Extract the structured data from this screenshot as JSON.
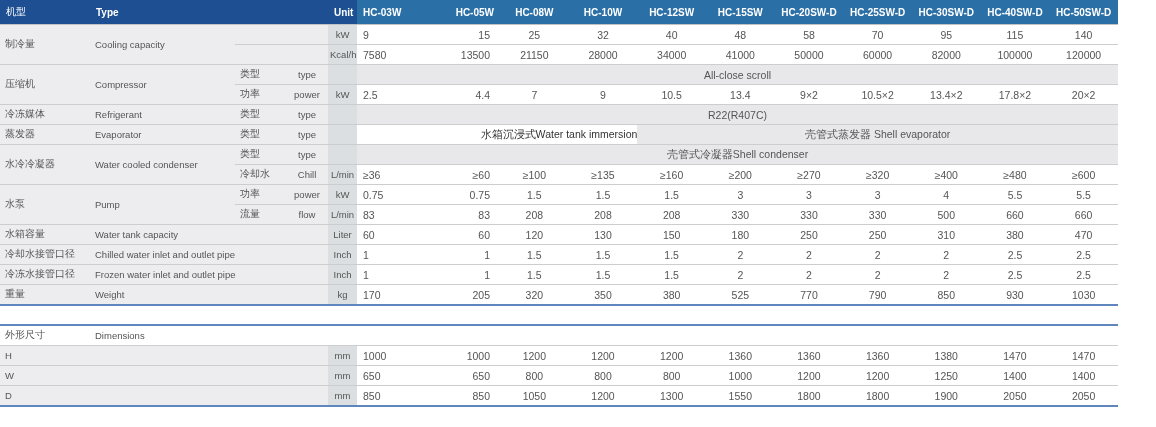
{
  "header": {
    "type_zh": "机型",
    "type_en": "Type",
    "unit": "Unit",
    "models": [
      "HC-03W",
      "HC-05W",
      "HC-08W",
      "HC-10W",
      "HC-12SW",
      "HC-15SW",
      "HC-20SW-D",
      "HC-25SW-D",
      "HC-30SW-D",
      "HC-40SW-D",
      "HC-50SW-D"
    ]
  },
  "specs": [
    {
      "zh": "制冷量",
      "en": "Cooling capacity",
      "rows": [
        {
          "unit": "kW",
          "values": [
            "9",
            "15",
            "25",
            "32",
            "40",
            "48",
            "58",
            "70",
            "95",
            "115",
            "140"
          ]
        },
        {
          "unit": "Kcal/h",
          "values": [
            "7580",
            "13500",
            "21150",
            "28000",
            "34000",
            "41000",
            "50000",
            "60000",
            "82000",
            "100000",
            "120000"
          ]
        }
      ]
    },
    {
      "zh": "压缩机",
      "en": "Compressor",
      "rows": [
        {
          "sub_zh": "类型",
          "sub_en": "type",
          "segments": [
            {
              "text": "All-close scroll",
              "shaded": true
            }
          ]
        },
        {
          "sub_zh": "功率",
          "sub_en": "power",
          "unit": "kW",
          "values": [
            "2.5",
            "4.4",
            "7",
            "9",
            "10.5",
            "13.4",
            "9×2",
            "10.5×2",
            "13.4×2",
            "17.8×2",
            "20×2"
          ]
        }
      ]
    },
    {
      "zh": "冷冻媒体",
      "en": "Refrigerant",
      "rows": [
        {
          "sub_zh": "类型",
          "sub_en": "type",
          "segments": [
            {
              "text": "R22(R407C)",
              "shaded": true
            }
          ]
        }
      ]
    },
    {
      "zh": "蒸发器",
      "en": "Evaporator",
      "rows": [
        {
          "sub_zh": "类型",
          "sub_en": "type",
          "segments": [
            {
              "text": "水箱沉浸式Water tank immersion",
              "shaded": false
            },
            {
              "text": "壳管式蒸发器 Shell evaporator",
              "shaded": true
            }
          ]
        }
      ]
    },
    {
      "zh": "水冷冷凝器",
      "en": "Water cooled condenser",
      "rows": [
        {
          "sub_zh": "类型",
          "sub_en": "type",
          "segments": [
            {
              "text": "壳管式冷凝器Shell condenser",
              "shaded": true
            }
          ]
        },
        {
          "sub_zh": "冷却水",
          "sub_en": "Chill",
          "unit": "L/min",
          "values": [
            "≥36",
            "≥60",
            "≥100",
            "≥135",
            "≥160",
            "≥200",
            "≥270",
            "≥320",
            "≥400",
            "≥480",
            "≥600"
          ]
        }
      ]
    },
    {
      "zh": "水泵",
      "en": "Pump",
      "rows": [
        {
          "sub_zh": "功率",
          "sub_en": "power",
          "unit": "kW",
          "values": [
            "0.75",
            "0.75",
            "1.5",
            "1.5",
            "1.5",
            "3",
            "3",
            "3",
            "4",
            "5.5",
            "5.5"
          ]
        },
        {
          "sub_zh": "流量",
          "sub_en": "flow",
          "unit": "L/min",
          "values": [
            "83",
            "83",
            "208",
            "208",
            "208",
            "330",
            "330",
            "330",
            "500",
            "660",
            "660"
          ]
        }
      ]
    },
    {
      "zh": "水箱容量",
      "en": "Water tank capacity",
      "rows": [
        {
          "unit": "Liter",
          "values": [
            "60",
            "60",
            "120",
            "130",
            "150",
            "180",
            "250",
            "250",
            "310",
            "380",
            "470"
          ]
        }
      ]
    },
    {
      "zh": "冷却水接管口径",
      "en": "Chilled water inlet and outlet pipe",
      "rows": [
        {
          "unit": "Inch",
          "values": [
            "1",
            "1",
            "1.5",
            "1.5",
            "1.5",
            "2",
            "2",
            "2",
            "2",
            "2.5",
            "2.5"
          ]
        }
      ]
    },
    {
      "zh": "冷冻水接管口径",
      "en": "Frozen water inlet and outlet pipe",
      "rows": [
        {
          "unit": "Inch",
          "values": [
            "1",
            "1",
            "1.5",
            "1.5",
            "1.5",
            "2",
            "2",
            "2",
            "2",
            "2.5",
            "2.5"
          ]
        }
      ]
    },
    {
      "zh": "重量",
      "en": "Weight",
      "rows": [
        {
          "unit": "kg",
          "values": [
            "170",
            "205",
            "320",
            "350",
            "380",
            "525",
            "770",
            "790",
            "850",
            "930",
            "1030"
          ]
        }
      ]
    }
  ],
  "dimensions": {
    "zh": "外形尺寸",
    "en": "Dimensions",
    "rows": [
      {
        "label": "H",
        "unit": "mm",
        "values": [
          "1000",
          "1000",
          "1200",
          "1200",
          "1200",
          "1360",
          "1360",
          "1360",
          "1380",
          "1470",
          "1470"
        ]
      },
      {
        "label": "W",
        "unit": "mm",
        "values": [
          "650",
          "650",
          "800",
          "800",
          "800",
          "1000",
          "1200",
          "1200",
          "1250",
          "1400",
          "1400"
        ]
      },
      {
        "label": "D",
        "unit": "mm",
        "values": [
          "850",
          "850",
          "1050",
          "1200",
          "1300",
          "1550",
          "1800",
          "1800",
          "1900",
          "2050",
          "2050"
        ]
      }
    ]
  }
}
